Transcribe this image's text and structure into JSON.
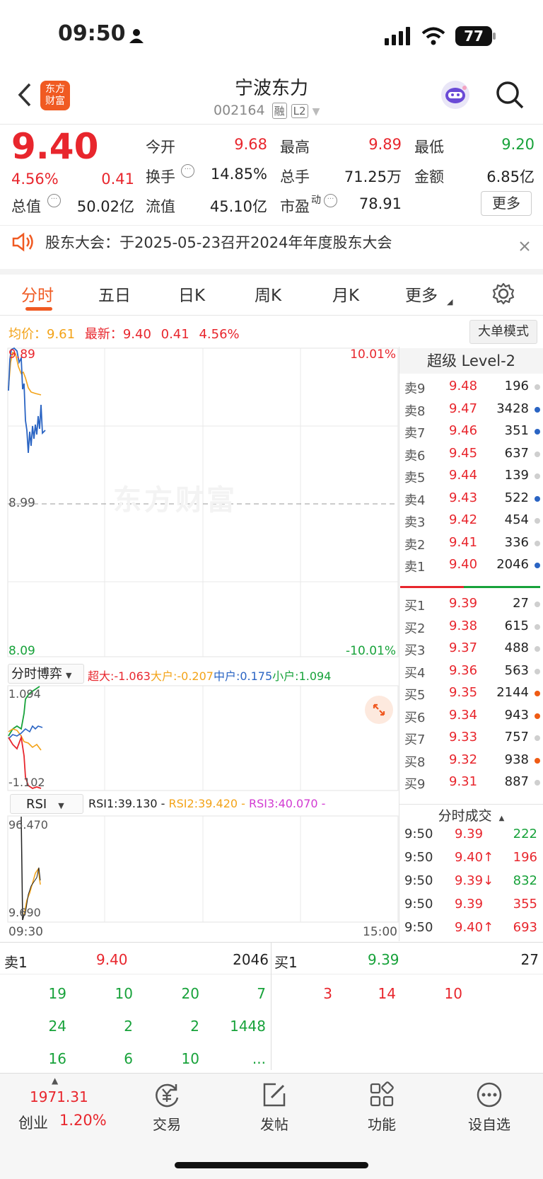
{
  "status_bar": {
    "time": "09:50",
    "battery": "77"
  },
  "header": {
    "title": "宁波东力",
    "code": "002164",
    "badge_rong": "融",
    "badge_l2": "L2",
    "logo_line1": "东方",
    "logo_line2": "财富"
  },
  "quote": {
    "price": "9.40",
    "pct": "4.56%",
    "change": "0.41",
    "open_label": "今开",
    "open": "9.68",
    "high_label": "最高",
    "high": "9.89",
    "low_label": "最低",
    "low": "9.20",
    "turnover_label": "换手",
    "turnover": "14.85%",
    "volume_label": "总手",
    "volume": "71.25万",
    "amount_label": "金额",
    "amount": "6.85亿",
    "mcap_label": "总值",
    "mcap": "50.02亿",
    "float_label": "流值",
    "float": "45.10亿",
    "pe_label": "市盈",
    "pe_sup": "动",
    "pe": "78.91",
    "more_button": "更多"
  },
  "notice": {
    "text": "股东大会：于2025-05-23召开2024年年度股东大会"
  },
  "tabs": [
    "分时",
    "五日",
    "日K",
    "周K",
    "月K",
    "更多"
  ],
  "chart_info": {
    "avg_label": "均价：",
    "avg": "9.61",
    "latest_label": "最新：",
    "latest": "9.40",
    "change": "0.41",
    "pct": "4.56%",
    "mode_button": "大单模式"
  },
  "chart_labels": {
    "top": "9.89",
    "mid": "8.99",
    "bottom": "8.09",
    "top_pct": "10.01%",
    "bottom_pct": "-10.01%",
    "watermark": "东方财富",
    "time_start": "09:30",
    "time_end": "15:00"
  },
  "game_panel": {
    "selector": "分时博弈",
    "super": "超大:-1.063",
    "big": "大户:-0.207",
    "mid": "中户:0.175",
    "small": "小户:1.094",
    "max": "1.094",
    "min": "-1.102"
  },
  "rsi_panel": {
    "selector": "RSI",
    "rsi1": "RSI1:39.130 -",
    "rsi2": "RSI2:39.420 -",
    "rsi3": "RSI3:40.070 -",
    "max": "96.470",
    "min": "9.690"
  },
  "level2": {
    "title": "超级 Level-2",
    "asks": [
      {
        "label": "卖9",
        "price": "9.48",
        "vol": "196",
        "dot": "#cfcfcf"
      },
      {
        "label": "卖8",
        "price": "9.47",
        "vol": "3428",
        "dot": "#2a64c3"
      },
      {
        "label": "卖7",
        "price": "9.46",
        "vol": "351",
        "dot": "#2a64c3"
      },
      {
        "label": "卖6",
        "price": "9.45",
        "vol": "637",
        "dot": "#cfcfcf"
      },
      {
        "label": "卖5",
        "price": "9.44",
        "vol": "139",
        "dot": "#cfcfcf"
      },
      {
        "label": "卖4",
        "price": "9.43",
        "vol": "522",
        "dot": "#2a64c3"
      },
      {
        "label": "卖3",
        "price": "9.42",
        "vol": "454",
        "dot": "#cfcfcf"
      },
      {
        "label": "卖2",
        "price": "9.41",
        "vol": "336",
        "dot": "#cfcfcf"
      },
      {
        "label": "卖1",
        "price": "9.40",
        "vol": "2046",
        "dot": "#2a64c3"
      }
    ],
    "bids": [
      {
        "label": "买1",
        "price": "9.39",
        "vol": "27",
        "dot": "#cfcfcf"
      },
      {
        "label": "买2",
        "price": "9.38",
        "vol": "615",
        "dot": "#cfcfcf"
      },
      {
        "label": "买3",
        "price": "9.37",
        "vol": "488",
        "dot": "#cfcfcf"
      },
      {
        "label": "买4",
        "price": "9.36",
        "vol": "563",
        "dot": "#cfcfcf"
      },
      {
        "label": "买5",
        "price": "9.35",
        "vol": "2144",
        "dot": "#ef5b14"
      },
      {
        "label": "买6",
        "price": "9.34",
        "vol": "943",
        "dot": "#ef5b14"
      },
      {
        "label": "买7",
        "price": "9.33",
        "vol": "757",
        "dot": "#cfcfcf"
      },
      {
        "label": "买8",
        "price": "9.32",
        "vol": "938",
        "dot": "#ef5b14"
      },
      {
        "label": "买9",
        "price": "9.31",
        "vol": "887",
        "dot": "#cfcfcf"
      }
    ],
    "trades_title": "分时成交",
    "trades": [
      {
        "time": "9:50",
        "price": "9.39",
        "vol": "222",
        "vol_color": "green"
      },
      {
        "time": "9:50",
        "price": "9.40↑",
        "vol": "196",
        "vol_color": "red"
      },
      {
        "time": "9:50",
        "price": "9.39↓",
        "vol": "832",
        "vol_color": "green"
      },
      {
        "time": "9:50",
        "price": "9.39",
        "vol": "355",
        "vol_color": "red"
      },
      {
        "time": "9:50",
        "price": "9.40↑",
        "vol": "693",
        "vol_color": "red"
      }
    ]
  },
  "queue": {
    "ask_label": "卖1",
    "ask_price": "9.40",
    "ask_vol": "2046",
    "bid_label": "买1",
    "bid_price": "9.39",
    "bid_vol": "27",
    "ask_rows": [
      [
        "19",
        "10",
        "20",
        "7"
      ],
      [
        "24",
        "2",
        "2",
        "1448"
      ],
      [
        "16",
        "6",
        "10",
        "..."
      ]
    ],
    "bid_rows": [
      [
        "3",
        "14",
        "10"
      ]
    ]
  },
  "bottom_nav": {
    "index_value": "1971.31",
    "index_name": "创业",
    "index_pct": "1.20%",
    "items": [
      "交易",
      "发帖",
      "功能",
      "设自选"
    ]
  }
}
